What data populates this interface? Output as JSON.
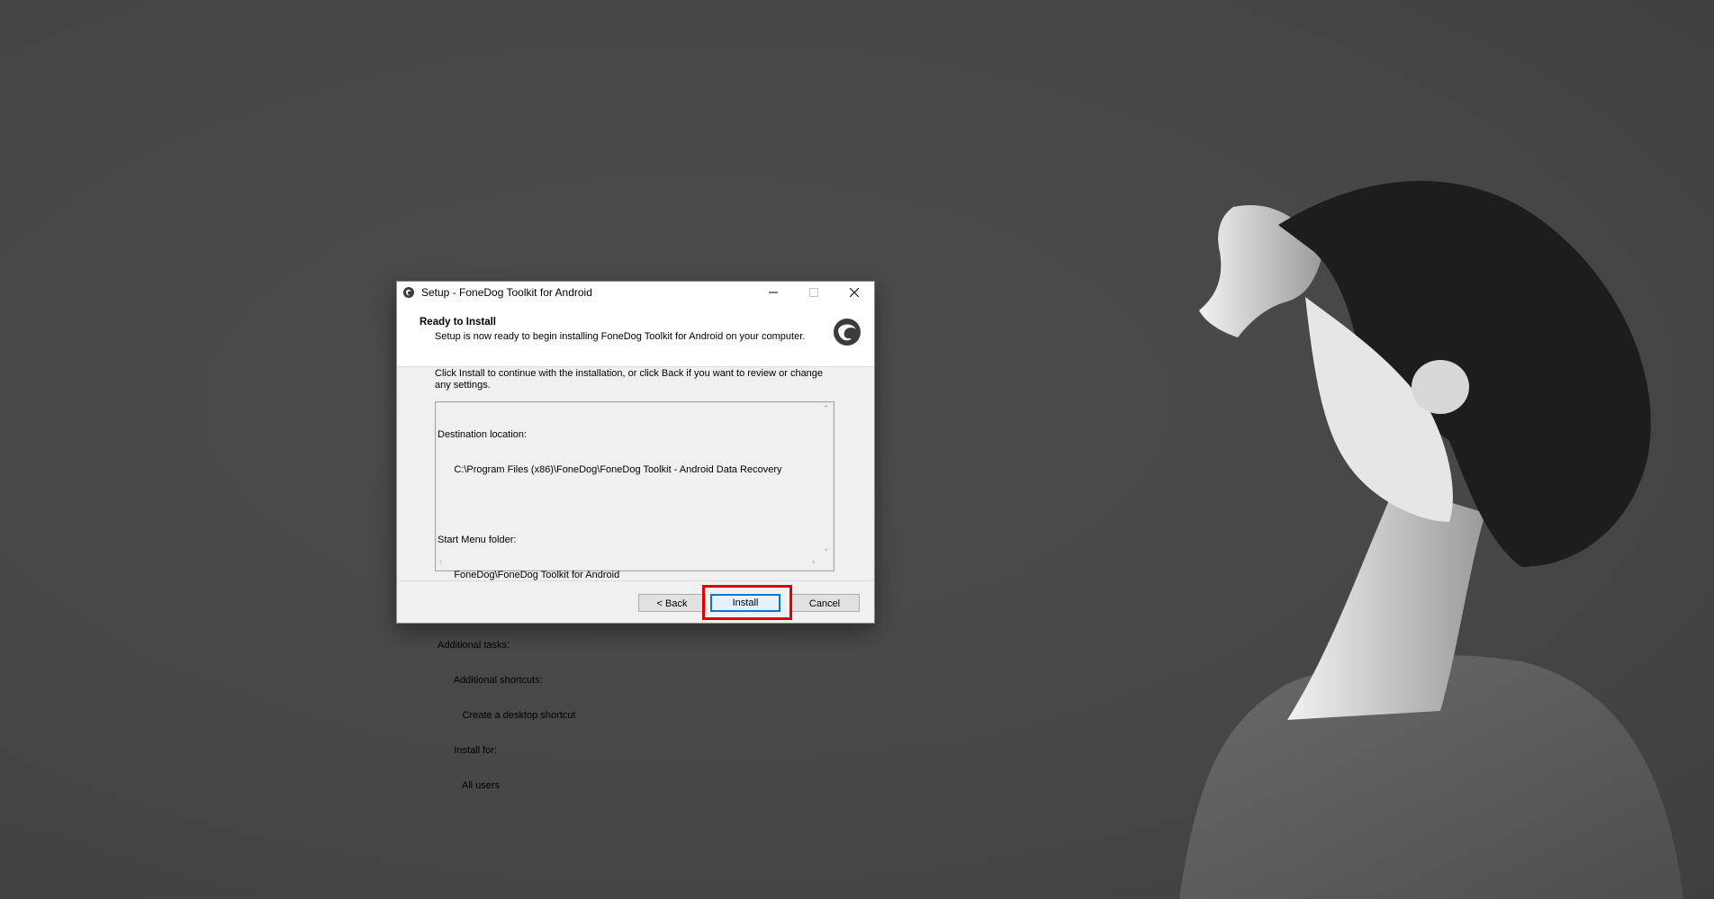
{
  "dialog": {
    "title": "Setup - FoneDog Toolkit for Android",
    "header_title": "Ready to Install",
    "header_subtitle": "Setup is now ready to begin installing FoneDog Toolkit for Android on your computer.",
    "body_text": "Click Install to continue with the installation, or click Back if you want to review or change any settings.",
    "memo_lines": [
      "Destination location:",
      "      C:\\Program Files (x86)\\FoneDog\\FoneDog Toolkit - Android Data Recovery",
      "",
      "Start Menu folder:",
      "      FoneDog\\FoneDog Toolkit for Android",
      "",
      "Additional tasks:",
      "      Additional shortcuts:",
      "         Create a desktop shortcut",
      "      Install for:",
      "         All users"
    ],
    "buttons": {
      "back": "< Back",
      "install": "Install",
      "cancel": "Cancel"
    }
  },
  "colors": {
    "highlight": "#e00000",
    "default_button_border": "#0078d7",
    "desktop_background": "#474747"
  },
  "icons": {
    "app": "fonedog-app-icon",
    "logo": "fonedog-logo-icon",
    "minimize": "minimize-icon",
    "maximize": "maximize-icon",
    "close": "close-icon"
  }
}
